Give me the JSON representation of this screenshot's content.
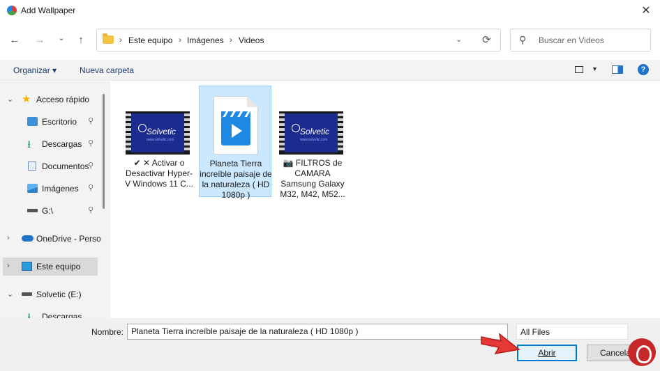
{
  "window": {
    "title": "Add Wallpaper",
    "close_glyph": "✕"
  },
  "nav": {
    "back": "←",
    "forward": "→",
    "recent": "⌄",
    "up": "↑",
    "breadcrumb": [
      "Este equipo",
      "Imágenes",
      "Videos"
    ],
    "separator": "›",
    "search_placeholder": "Buscar en Videos"
  },
  "commandbar": {
    "organize": "Organizar",
    "new_folder": "Nueva carpeta",
    "help": "?"
  },
  "sidebar": {
    "items": [
      {
        "label": "Acceso rápido",
        "icon": "star-icon"
      },
      {
        "label": "Escritorio",
        "icon": "desktop-icon",
        "pinned": true
      },
      {
        "label": "Descargas",
        "icon": "download-icon",
        "pinned": true
      },
      {
        "label": "Documentos",
        "icon": "document-icon",
        "pinned": true
      },
      {
        "label": "Imágenes",
        "icon": "picture-icon",
        "pinned": true
      },
      {
        "label": "G:\\",
        "icon": "drive-icon",
        "pinned": true
      },
      {
        "label": "OneDrive - Perso",
        "icon": "cloud-icon"
      },
      {
        "label": "Este equipo",
        "icon": "pc-icon",
        "selected": true
      },
      {
        "label": "Solvetic (E:)",
        "icon": "drive-icon"
      },
      {
        "label": "Descargas",
        "icon": "download-icon"
      }
    ],
    "expand_glyph": "⌄",
    "collapsed_glyph": "›",
    "pin_glyph": "📌"
  },
  "files": [
    {
      "name": "✔ ✕ Activar o Desactivar Hyper-V Windows 11 C...",
      "type": "video-thumbnail",
      "brand": "Solvetic",
      "sub": "www.solvetic.com"
    },
    {
      "name": "Planeta Tierra increíble paisaje de la naturaleza ( HD 1080p )",
      "type": "video-file",
      "selected": true
    },
    {
      "name": "📷 FILTROS de CAMARA Samsung Galaxy M32, M42, M52...",
      "type": "video-thumbnail",
      "brand": "Solvetic",
      "sub": "www.solvetic.com"
    }
  ],
  "footer": {
    "filename_label": "Nombre:",
    "filename_value": "Planeta Tierra increíble paisaje de la naturaleza ( HD 1080p )",
    "filter": "All Files",
    "open_button": "Abrir",
    "cancel_button": "Cancelar"
  },
  "colors": {
    "selection": "#cce8ff",
    "accent": "#0078d4",
    "arrow": "#e53935"
  }
}
